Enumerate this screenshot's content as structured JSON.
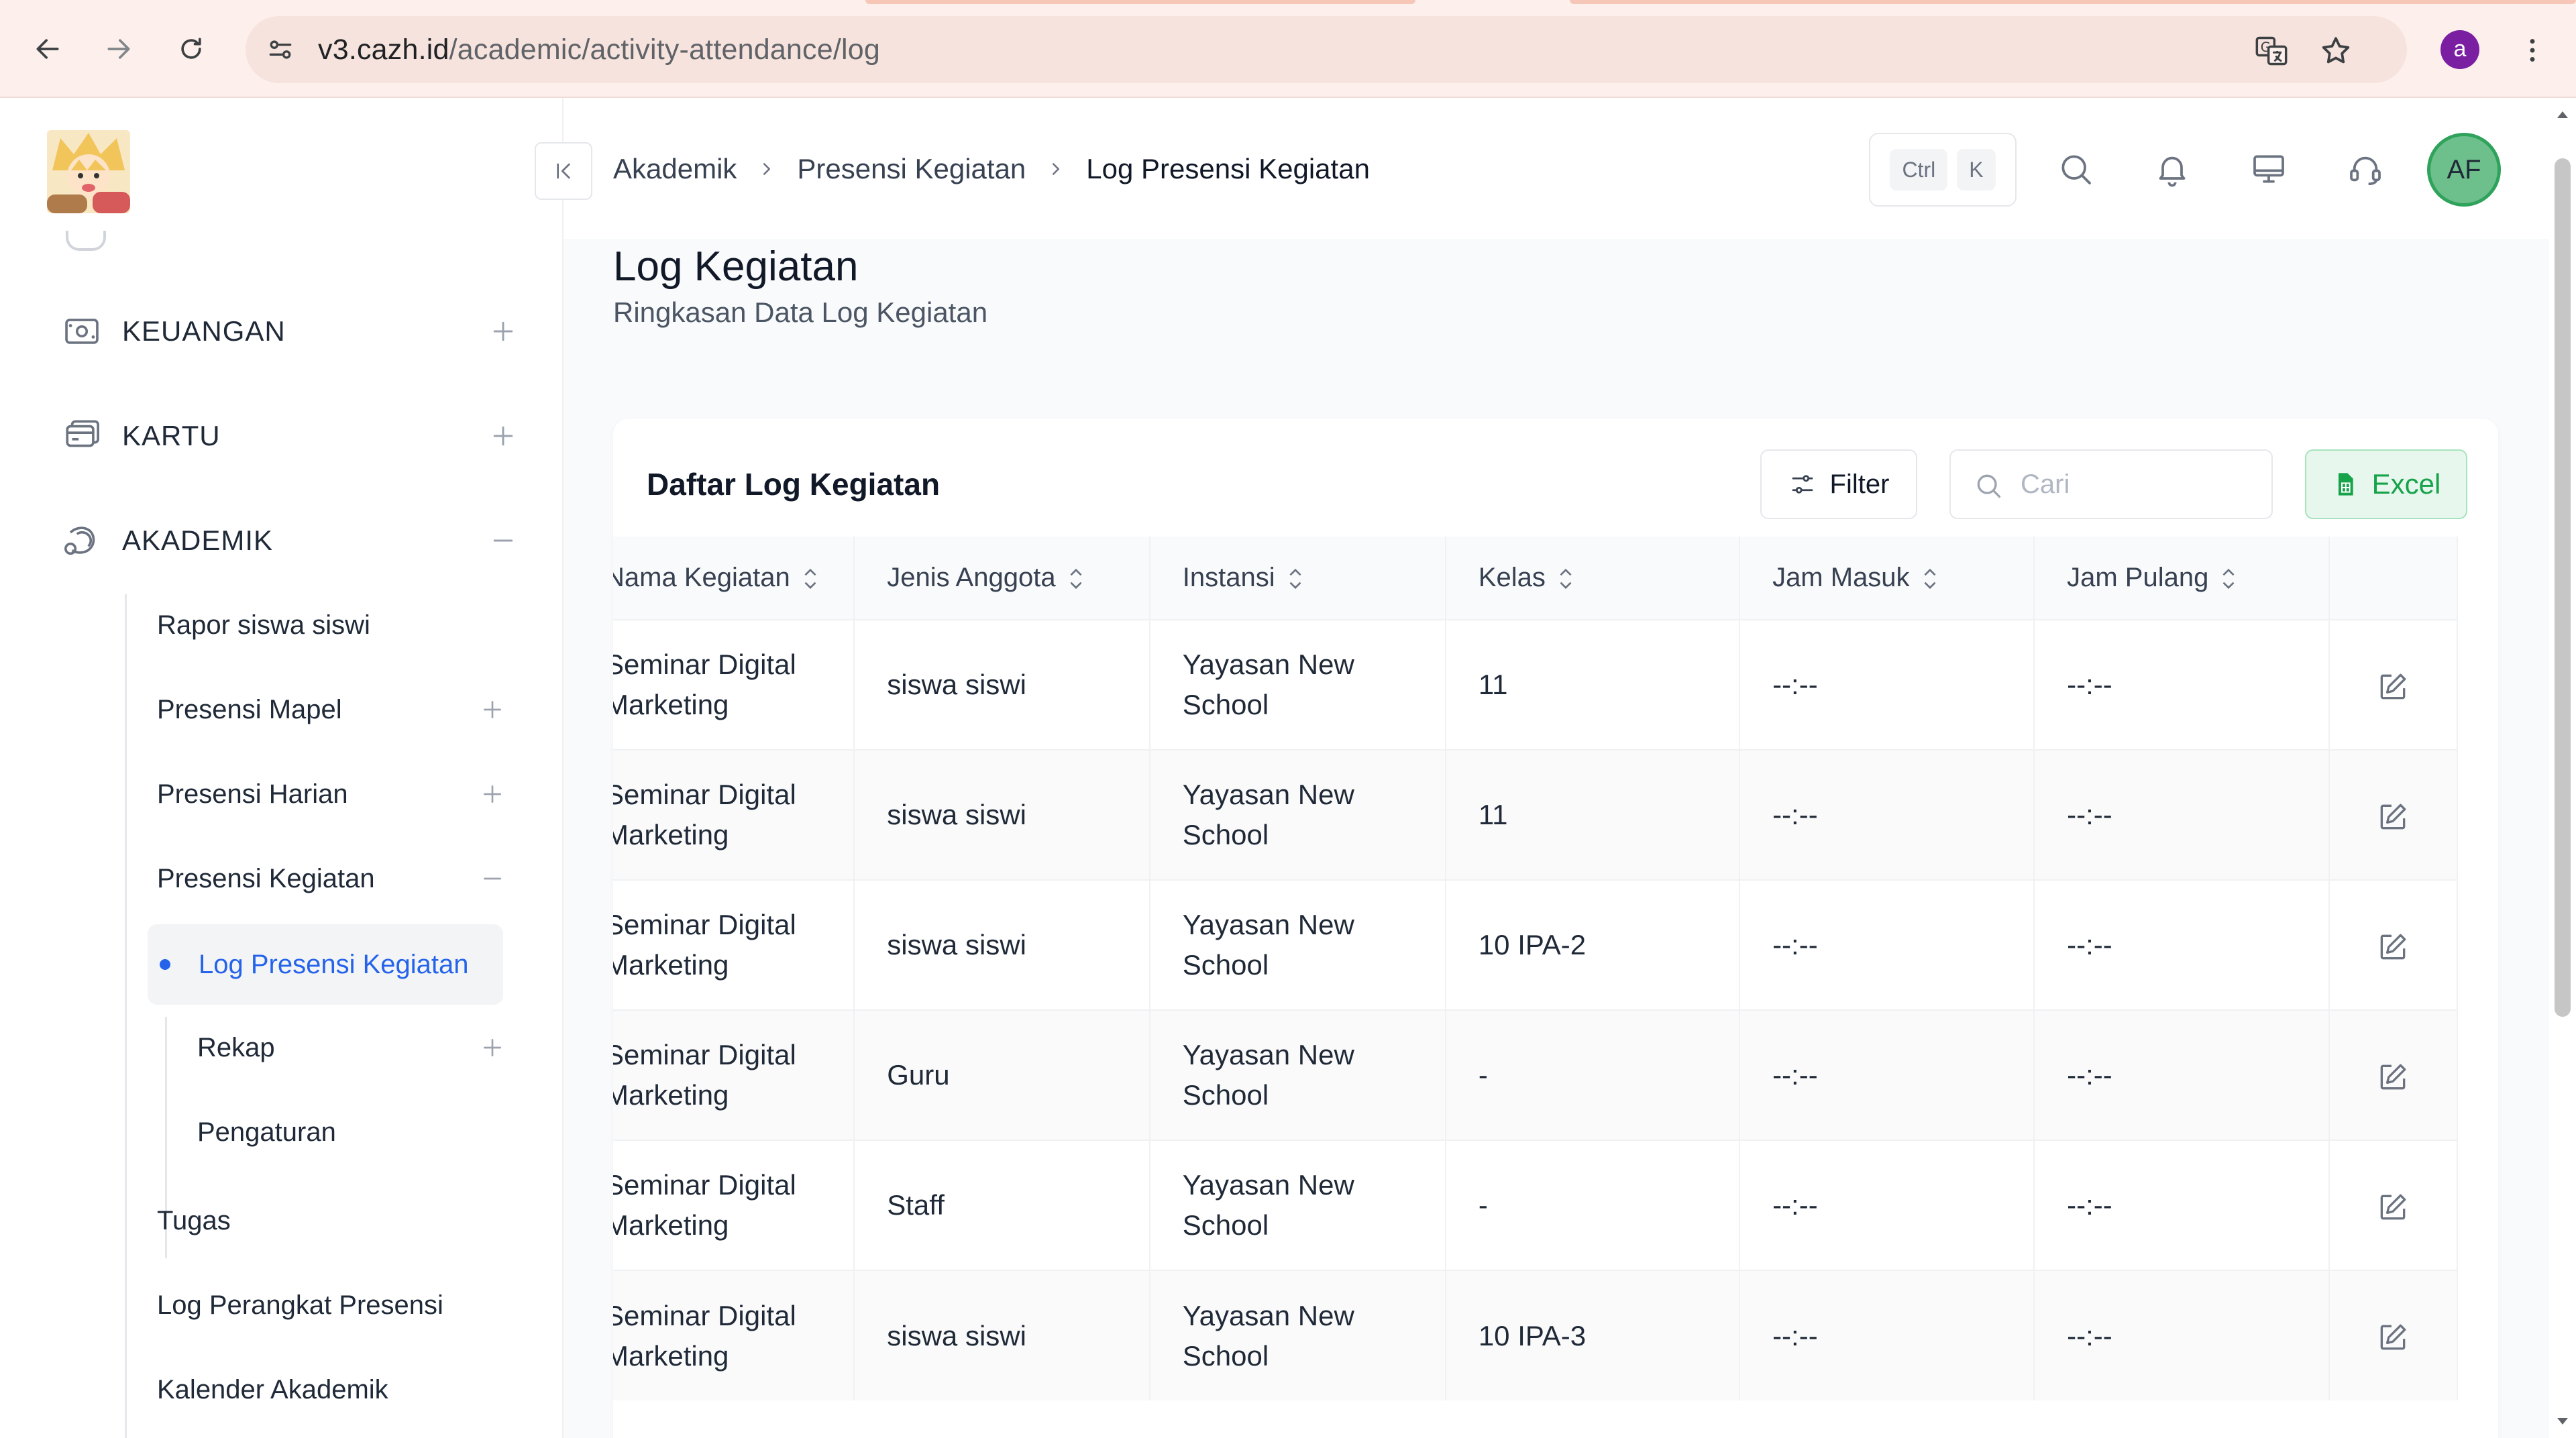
{
  "browser": {
    "url_host": "v3.cazh.id",
    "url_path": "/academic/activity-attendance/log",
    "profile_initial": "a"
  },
  "sidebar": {
    "top_items": [
      {
        "label": "KEUANGAN",
        "icon": "wallet-icon",
        "toggle": "plus"
      },
      {
        "label": "KARTU",
        "icon": "card-icon",
        "toggle": "plus"
      },
      {
        "label": "AKADEMIK",
        "icon": "academic-icon",
        "toggle": "minus"
      }
    ],
    "akademik_items": [
      {
        "label": "Rapor siswa siswi"
      },
      {
        "label": "Presensi Mapel"
      },
      {
        "label": "Presensi Harian"
      },
      {
        "label": "Presensi Kegiatan"
      }
    ],
    "kegiatan_items": [
      {
        "label": "Log Presensi Kegiatan"
      },
      {
        "label": "Rekap"
      },
      {
        "label": "Pengaturan"
      }
    ],
    "bottom_items": [
      {
        "label": "Tugas"
      },
      {
        "label": "Log Perangkat Presensi"
      },
      {
        "label": "Kalender Akademik"
      }
    ]
  },
  "header": {
    "breadcrumb": [
      "Akademik",
      "Presensi Kegiatan",
      "Log Presensi Kegiatan"
    ],
    "shortcut": [
      "Ctrl",
      "K"
    ],
    "avatar_initials": "AF"
  },
  "page": {
    "title": "Log Kegiatan",
    "subtitle": "Ringkasan Data Log Kegiatan"
  },
  "card": {
    "title": "Daftar Log Kegiatan",
    "filter_label": "Filter",
    "search_placeholder": "Cari",
    "excel_label": "Excel"
  },
  "table": {
    "columns": [
      "Nama Kegiatan",
      "Jenis Anggota",
      "Instansi",
      "Kelas",
      "Jam Masuk",
      "Jam Pulang"
    ],
    "rows": [
      {
        "kegiatan": "Seminar Digital Marketing",
        "jenis": "siswa siswi",
        "instansi": "Yayasan New School",
        "kelas": "11",
        "masuk": "--:--",
        "pulang": "--:--"
      },
      {
        "kegiatan": "Seminar Digital Marketing",
        "jenis": "siswa siswi",
        "instansi": "Yayasan New School",
        "kelas": "11",
        "masuk": "--:--",
        "pulang": "--:--"
      },
      {
        "kegiatan": "Seminar Digital Marketing",
        "jenis": "siswa siswi",
        "instansi": "Yayasan New School",
        "kelas": "10 IPA-2",
        "masuk": "--:--",
        "pulang": "--:--"
      },
      {
        "kegiatan": "Seminar Digital Marketing",
        "jenis": "Guru",
        "instansi": "Yayasan New School",
        "kelas": "-",
        "masuk": "--:--",
        "pulang": "--:--"
      },
      {
        "kegiatan": "Seminar Digital Marketing",
        "jenis": "Staff",
        "instansi": "Yayasan New School",
        "kelas": "-",
        "masuk": "--:--",
        "pulang": "--:--"
      },
      {
        "kegiatan": "Seminar Digital Marketing",
        "jenis": "siswa siswi",
        "instansi": "Yayasan New School",
        "kelas": "10 IPA-3",
        "masuk": "--:--",
        "pulang": "--:--"
      }
    ]
  },
  "colors": {
    "accent_blue": "#2563eb",
    "excel_green": "#16a34a",
    "avatar_green": "#6dbf8b"
  }
}
